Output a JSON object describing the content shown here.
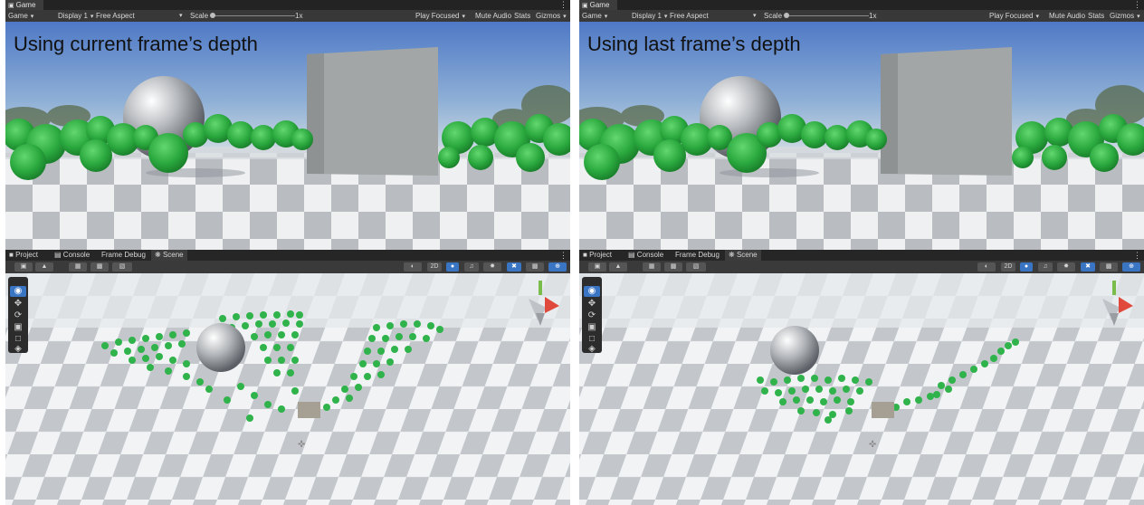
{
  "panes": [
    {
      "tab_label": "Game",
      "toolbar": {
        "game_dropdown": "Game",
        "display_dropdown": "Display 1",
        "aspect_dropdown": "Free Aspect",
        "scale_label": "Scale",
        "scale_value": "1x",
        "play_focused": "Play Focused",
        "mute_audio": "Mute Audio",
        "stats": "Stats",
        "gizmos": "Gizmos"
      },
      "caption": "Using current frame’s depth",
      "scene_tabs": {
        "project": "Project",
        "console": "Console",
        "frame_debug": "Frame Debug",
        "scene": "Scene"
      },
      "scene_toolbar": {
        "two_d": "2D"
      }
    },
    {
      "tab_label": "Game",
      "toolbar": {
        "game_dropdown": "Game",
        "display_dropdown": "Display 1",
        "aspect_dropdown": "Free Aspect",
        "scale_label": "Scale",
        "scale_value": "1x",
        "play_focused": "Play Focused",
        "mute_audio": "Mute Audio",
        "stats": "Stats",
        "gizmos": "Gizmos"
      },
      "caption": "Using last frame’s depth",
      "scene_tabs": {
        "project": "Project",
        "console": "Console",
        "frame_debug": "Frame Debug",
        "scene": "Scene"
      },
      "scene_toolbar": {
        "two_d": "2D"
      }
    }
  ],
  "colors": {
    "editor_bg": "#383838",
    "accent": "#3a75c4",
    "ball_green": "#2fb34a",
    "sky_top": "#4f79c6",
    "floor_light": "#eef0f2",
    "floor_dark": "#b8bcc1"
  }
}
